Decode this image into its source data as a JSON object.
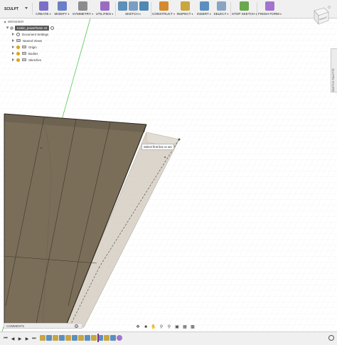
{
  "toolbar": {
    "workspace": "SCULPT",
    "groups": [
      {
        "label": "CREATE",
        "icons": [
          "create-form-icon"
        ],
        "colors": [
          "#7a6fc9"
        ]
      },
      {
        "label": "MODIFY",
        "icons": [
          "modify-icon"
        ],
        "colors": [
          "#6b7fc7"
        ]
      },
      {
        "label": "SYMMETRY",
        "icons": [
          "symmetry-icon"
        ],
        "colors": [
          "#8c8c8c"
        ]
      },
      {
        "label": "UTILITIES",
        "icons": [
          "utilities-icon"
        ],
        "colors": [
          "#9b6bc3"
        ]
      },
      {
        "label": "SKETCH",
        "icons": [
          "sketch-line-icon",
          "sketch-arc-icon",
          "sketch-rect-icon"
        ],
        "colors": [
          "#5d8fb8",
          "#7a9ec2",
          "#4f88b3"
        ]
      },
      {
        "label": "CONSTRUCT",
        "icons": [
          "construct-plane-icon"
        ],
        "colors": [
          "#d48a2f"
        ]
      },
      {
        "label": "INSPECT",
        "icons": [
          "inspect-measure-icon"
        ],
        "colors": [
          "#c9a640"
        ]
      },
      {
        "label": "INSERT",
        "icons": [
          "insert-image-icon"
        ],
        "colors": [
          "#5b8fbf"
        ]
      },
      {
        "label": "SELECT",
        "icons": [
          "select-arrow-icon"
        ],
        "colors": [
          "#8aa4c2"
        ]
      },
      {
        "label": "STOP SKETCH",
        "icons": [
          "stop-sketch-icon"
        ],
        "colors": [
          "#6aa84f"
        ]
      },
      {
        "label": "FINISH FORM",
        "icons": [
          "finish-form-icon"
        ],
        "colors": [
          "#a274cf"
        ]
      }
    ]
  },
  "viewcube": {
    "label": "FRONT"
  },
  "browser": {
    "header": "BROWSER",
    "document": "tonkin_powerframe v2",
    "items": [
      {
        "label": "Document Settings",
        "icon": "gear-icon"
      },
      {
        "label": "Named Views",
        "icon": "folder-icon"
      },
      {
        "label": "Origin",
        "icon": "folder-icon"
      },
      {
        "label": "Bodies",
        "icon": "folder-icon"
      },
      {
        "label": "Sketches",
        "icon": "folder-icon"
      }
    ]
  },
  "side_tab": {
    "label": "SKETCH PALETTE"
  },
  "tooltip": {
    "text": "Select first line or arc"
  },
  "comments": {
    "label": "COMMENTS"
  },
  "colors": {
    "wood_face": "#7a6e59",
    "wood_dark": "#5d5546",
    "transparent_face": "#c9bfb1",
    "axis_green": "#3fbf3f",
    "grid_line": "#e6e6e6",
    "timeline_marker": "#7b2ea3"
  }
}
